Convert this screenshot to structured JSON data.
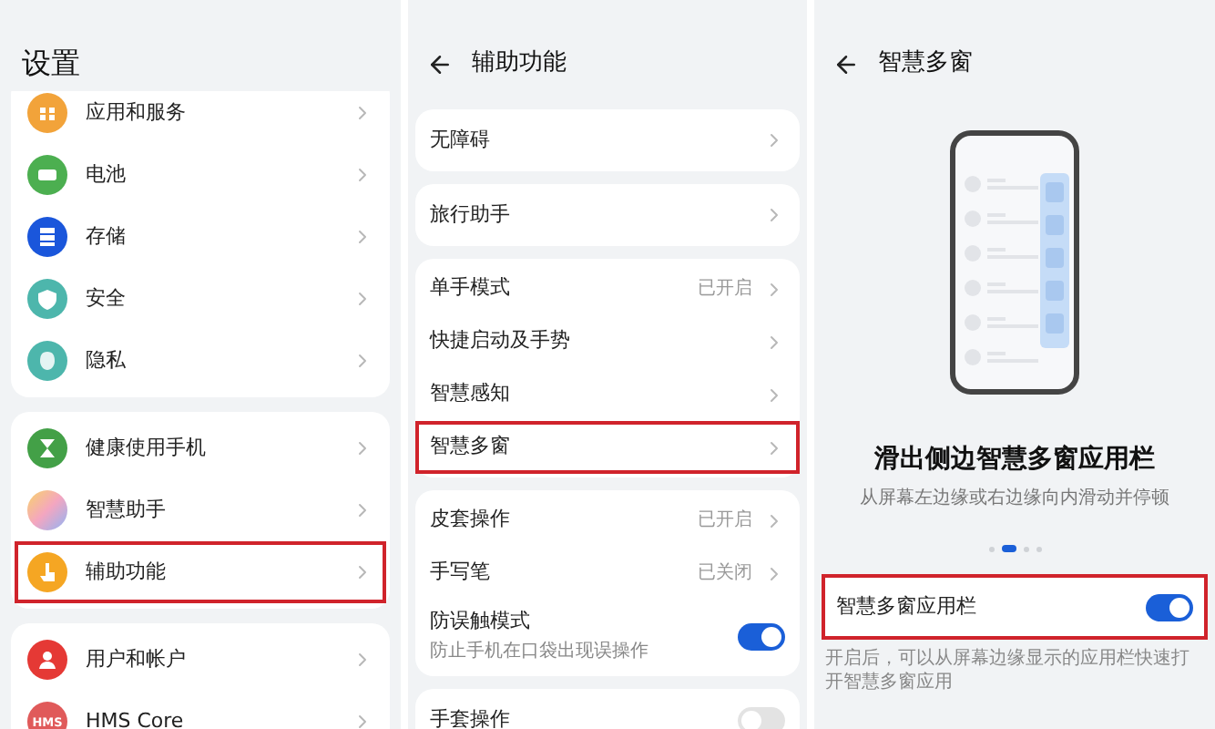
{
  "settings": {
    "title": "设置",
    "groups": [
      {
        "items": [
          {
            "label": "应用和服务",
            "kind": "apps",
            "color": "#f2a33a",
            "highlighted": false
          },
          {
            "label": "电池",
            "kind": "battery",
            "color": "#4caf50",
            "highlighted": false
          },
          {
            "label": "存储",
            "kind": "storage",
            "color": "#1a56db",
            "highlighted": false
          },
          {
            "label": "安全",
            "kind": "shield",
            "color": "#4db6ac",
            "highlighted": false
          },
          {
            "label": "隐私",
            "kind": "privacy",
            "color": "#4db6ac",
            "highlighted": false
          }
        ]
      },
      {
        "items": [
          {
            "label": "健康使用手机",
            "kind": "hourglass",
            "color": "#43a047",
            "highlighted": false
          },
          {
            "label": "智慧助手",
            "kind": "gradient",
            "highlighted": false
          },
          {
            "label": "辅助功能",
            "kind": "hand",
            "color": "#f5a623",
            "highlighted": true
          }
        ]
      },
      {
        "items": [
          {
            "label": "用户和帐户",
            "kind": "person",
            "color": "#e53935",
            "highlighted": false
          },
          {
            "label": "HMS Core",
            "kind": "badge",
            "badge": "HMS",
            "color": "#e05a5a",
            "highlighted": false
          }
        ]
      }
    ]
  },
  "accessibility": {
    "title": "辅助功能",
    "groups": [
      {
        "items": [
          {
            "kind": "link",
            "label": "无障碍",
            "highlighted": false
          }
        ]
      },
      {
        "items": [
          {
            "kind": "link",
            "label": "旅行助手",
            "highlighted": false
          }
        ]
      },
      {
        "items": [
          {
            "kind": "link",
            "label": "单手模式",
            "value": "已开启",
            "highlighted": false
          },
          {
            "kind": "link",
            "label": "快捷启动及手势",
            "highlighted": false
          },
          {
            "kind": "link",
            "label": "智慧感知",
            "highlighted": false
          },
          {
            "kind": "link",
            "label": "智慧多窗",
            "highlighted": true
          }
        ]
      },
      {
        "items": [
          {
            "kind": "link",
            "label": "皮套操作",
            "value": "已开启",
            "highlighted": false
          },
          {
            "kind": "link",
            "label": "手写笔",
            "value": "已关闭",
            "highlighted": false
          },
          {
            "kind": "toggle",
            "label": "防误触模式",
            "subtitle": "防止手机在口袋出现误操作",
            "on": true,
            "highlighted": false
          }
        ]
      },
      {
        "items": [
          {
            "kind": "toggle",
            "label": "手套操作",
            "on": false,
            "highlighted": false
          }
        ]
      }
    ]
  },
  "smart_multiwindow": {
    "title": "智慧多窗",
    "headline": "滑出侧边智慧多窗应用栏",
    "subtitle": "从屏幕左边缘或右边缘向内滑动并停顿",
    "pager": [
      {
        "selected": false
      },
      {
        "selected": true
      },
      {
        "selected": false
      },
      {
        "selected": false
      }
    ],
    "setting": {
      "label": "智慧多窗应用栏",
      "on": true,
      "highlighted": true
    },
    "note": "开启后，可以从屏幕边缘显示的应用栏快速打开智慧多窗应用"
  }
}
